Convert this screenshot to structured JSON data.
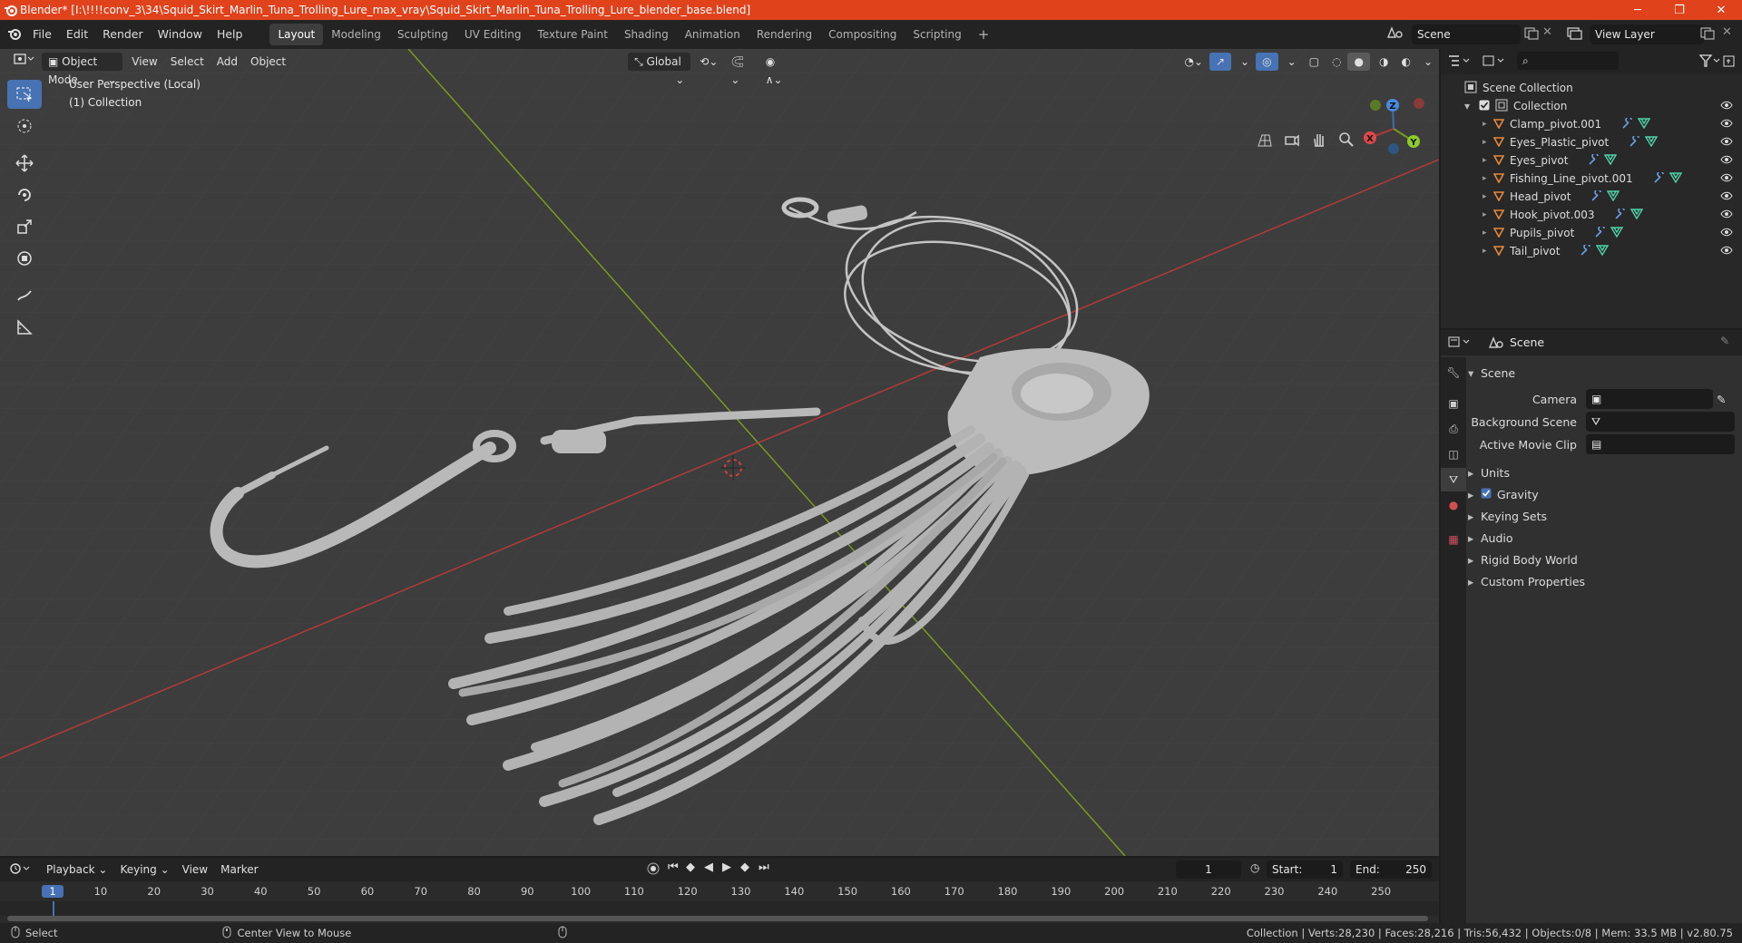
{
  "window": {
    "title": "Blender* [I:\\!!!!conv_3\\34\\Squid_Skirt_Marlin_Tuna_Trolling_Lure_max_vray\\Squid_Skirt_Marlin_Tuna_Trolling_Lure_blender_base.blend]",
    "minimize": "─",
    "maximize": "❐",
    "close": "✕"
  },
  "menu": [
    "File",
    "Edit",
    "Render",
    "Window",
    "Help"
  ],
  "workspaces": [
    "Layout",
    "Modeling",
    "Sculpting",
    "UV Editing",
    "Texture Paint",
    "Shading",
    "Animation",
    "Rendering",
    "Compositing",
    "Scripting"
  ],
  "workspace_add": "+",
  "scene_field": "Scene",
  "view_layer_field": "View Layer",
  "viewport": {
    "mode": "Object Mode",
    "menus": [
      "View",
      "Select",
      "Add",
      "Object"
    ],
    "orientation": "Global",
    "info_line1": "User Perspective (Local)",
    "info_line2": "(1) Collection",
    "gizmo": {
      "x": "X",
      "y": "Y",
      "z": "Z"
    }
  },
  "outliner": {
    "root": "Scene Collection",
    "collection": "Collection",
    "items": [
      "Clamp_pivot.001",
      "Eyes_Plastic_pivot",
      "Eyes_pivot",
      "Fishing_Line_pivot.001",
      "Head_pivot",
      "Hook_pivot.003",
      "Pupils_pivot",
      "Tail_pivot"
    ]
  },
  "properties": {
    "header": "Scene",
    "panel": "Scene",
    "fields": [
      {
        "label": "Camera"
      },
      {
        "label": "Background Scene"
      },
      {
        "label": "Active Movie Clip"
      }
    ],
    "sections": [
      "Units",
      "Gravity",
      "Keying Sets",
      "Audio",
      "Rigid Body World",
      "Custom Properties"
    ],
    "gravity_checked": true
  },
  "timeline": {
    "menus": [
      "Playback",
      "Keying",
      "View",
      "Marker"
    ],
    "current_frame": "1",
    "start_label": "Start:",
    "start": "1",
    "end_label": "End:",
    "end": "250",
    "ticks": [
      "1",
      "10",
      "20",
      "30",
      "40",
      "50",
      "60",
      "70",
      "80",
      "90",
      "100",
      "110",
      "120",
      "130",
      "140",
      "150",
      "160",
      "170",
      "180",
      "190",
      "200",
      "210",
      "220",
      "230",
      "240",
      "250"
    ]
  },
  "status": {
    "left1": "Select",
    "left2": "Center View to Mouse",
    "right": "Collection | Verts:28,230 | Faces:28,216 | Tris:56,432 | Objects:0/8 | Mem: 33.5 MB | v2.80.75"
  },
  "colors": {
    "titlebar": "#e0421c",
    "accent": "#4772b3",
    "x_axis": "#b33a3a",
    "y_axis": "#7a9a20",
    "object_icon": "#e6893a",
    "modifier_icon": "#6a9fe0",
    "mesh_icon": "#4fd1a8"
  }
}
